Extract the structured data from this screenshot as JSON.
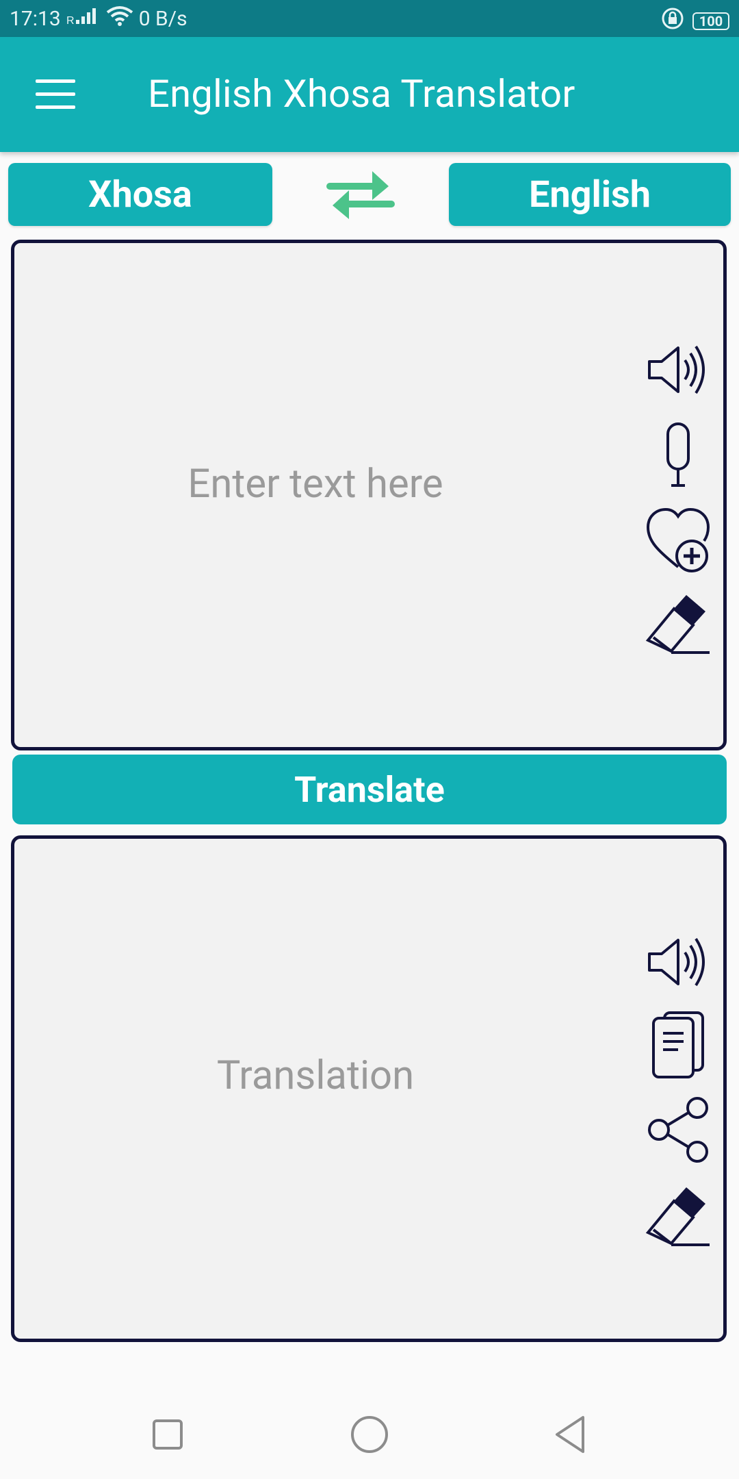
{
  "status_bar": {
    "time": "17:13",
    "network_speed": "0 B/s",
    "battery": "100"
  },
  "app_bar": {
    "title": "English Xhosa Translator",
    "menu_icon": "menu-icon"
  },
  "languages": {
    "source": "Xhosa",
    "target": "English",
    "swap_icon": "swap-arrows-icon",
    "swap_color": "#4cc38a"
  },
  "input_panel": {
    "placeholder": "Enter text here",
    "icons": [
      "speaker-icon",
      "microphone-icon",
      "favorite-add-icon",
      "eraser-icon"
    ]
  },
  "translate_button": {
    "label": "Translate"
  },
  "output_panel": {
    "placeholder": "Translation",
    "icons": [
      "speaker-icon",
      "copy-icon",
      "share-icon",
      "eraser-icon"
    ]
  },
  "colors": {
    "accent": "#12b0b5",
    "status_bar": "#0d7b86",
    "panel_border": "#12133b",
    "panel_bg": "#f2f2f2"
  }
}
